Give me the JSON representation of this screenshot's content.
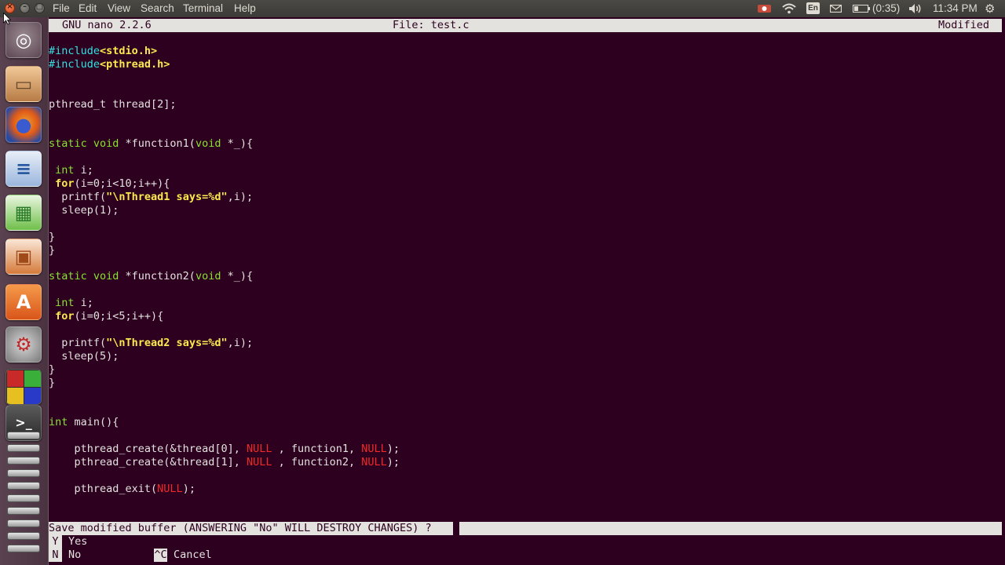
{
  "menubar": {
    "items": [
      "File",
      "Edit",
      "View",
      "Search",
      "Terminal",
      "Help"
    ]
  },
  "indicators": {
    "keyboard": "En",
    "battery": "(0:35)",
    "time": "11:34 PM",
    "gear": "⚙",
    "icons": [
      "record-icon",
      "wifi-icon",
      "keyboard-layout-icon",
      "mail-icon",
      "battery-icon",
      "volume-icon",
      "session-gear-icon"
    ]
  },
  "window_controls": {
    "close": "×",
    "minimize": "–",
    "maximize": "□"
  },
  "launcher": {
    "items": [
      "dash-home-icon",
      "files-icon",
      "firefox-icon",
      "libreoffice-writer-icon",
      "libreoffice-calc-icon",
      "libreoffice-impress-icon",
      "software-center-icon",
      "system-settings-icon",
      "workspace-switcher-icon",
      "terminal-icon"
    ],
    "glyphs": {
      "dash": "◎",
      "files": "▭",
      "firefox": "●",
      "writer": "≡",
      "calc": "▦",
      "impress": "▣",
      "software": "A",
      "settings": "⚙",
      "terminal": ">_"
    }
  },
  "nano": {
    "version": "GNU nano 2.2.6",
    "filename": "File: test.c",
    "status": "Modified"
  },
  "code": {
    "lines": [
      {
        "row": 0,
        "text": "",
        "tokens": [
          {
            "t": "#include",
            "c": "pre"
          },
          {
            "t": "<stdio.h>",
            "c": "inc"
          }
        ]
      },
      {
        "row": 1,
        "tokens": [
          {
            "t": "#include",
            "c": "pre"
          },
          {
            "t": "<pthread.h>",
            "c": "inc"
          }
        ]
      },
      {
        "row": 4,
        "tokens": [
          {
            "t": "pthread_t thread[2];",
            "c": "plain"
          }
        ]
      },
      {
        "row": 7,
        "tokens": [
          {
            "t": "static void",
            "c": "kw"
          },
          {
            "t": " *function1(",
            "c": "plain"
          },
          {
            "t": "void",
            "c": "kw"
          },
          {
            "t": " *_){",
            "c": "plain"
          }
        ]
      },
      {
        "row": 9,
        "tokens": [
          {
            "t": " int",
            "c": "kw"
          },
          {
            "t": " i;",
            "c": "plain"
          }
        ]
      },
      {
        "row": 10,
        "tokens": [
          {
            "t": " for",
            "c": "ctl"
          },
          {
            "t": "(i=0;i<10;i++){",
            "c": "plain"
          }
        ]
      },
      {
        "row": 11,
        "tokens": [
          {
            "t": "  printf(",
            "c": "plain"
          },
          {
            "t": "\"\\nThread1 says=%d\"",
            "c": "str"
          },
          {
            "t": ",i);",
            "c": "plain"
          }
        ]
      },
      {
        "row": 12,
        "tokens": [
          {
            "t": "  sleep(1);",
            "c": "plain"
          }
        ]
      },
      {
        "row": 14,
        "tokens": [
          {
            "t": "}",
            "c": "plain"
          }
        ]
      },
      {
        "row": 15,
        "tokens": [
          {
            "t": "}",
            "c": "plain"
          }
        ]
      },
      {
        "row": 17,
        "tokens": [
          {
            "t": "static void",
            "c": "kw"
          },
          {
            "t": " *function2(",
            "c": "plain"
          },
          {
            "t": "void",
            "c": "kw"
          },
          {
            "t": " *_){",
            "c": "plain"
          }
        ]
      },
      {
        "row": 19,
        "tokens": [
          {
            "t": " int",
            "c": "kw"
          },
          {
            "t": " i;",
            "c": "plain"
          }
        ]
      },
      {
        "row": 20,
        "tokens": [
          {
            "t": " for",
            "c": "ctl"
          },
          {
            "t": "(i=0;i<5;i++){",
            "c": "plain"
          }
        ]
      },
      {
        "row": 22,
        "tokens": [
          {
            "t": "  printf(",
            "c": "plain"
          },
          {
            "t": "\"\\nThread2 says=%d\"",
            "c": "str"
          },
          {
            "t": ",i);",
            "c": "plain"
          }
        ]
      },
      {
        "row": 23,
        "tokens": [
          {
            "t": "  sleep(5);",
            "c": "plain"
          }
        ]
      },
      {
        "row": 24,
        "tokens": [
          {
            "t": "}",
            "c": "plain"
          }
        ]
      },
      {
        "row": 25,
        "tokens": [
          {
            "t": "}",
            "c": "plain"
          }
        ]
      },
      {
        "row": 28,
        "tokens": [
          {
            "t": "int",
            "c": "kw"
          },
          {
            "t": " main(){",
            "c": "plain"
          }
        ]
      },
      {
        "row": 30,
        "tokens": [
          {
            "t": "    pthread_create(&thread[0], ",
            "c": "plain"
          },
          {
            "t": "NULL",
            "c": "null"
          },
          {
            "t": " , function1, ",
            "c": "plain"
          },
          {
            "t": "NULL",
            "c": "null"
          },
          {
            "t": ");",
            "c": "plain"
          }
        ]
      },
      {
        "row": 31,
        "tokens": [
          {
            "t": "    pthread_create(&thread[1], ",
            "c": "plain"
          },
          {
            "t": "NULL",
            "c": "null"
          },
          {
            "t": " , function2, ",
            "c": "plain"
          },
          {
            "t": "NULL",
            "c": "null"
          },
          {
            "t": ");",
            "c": "plain"
          }
        ]
      },
      {
        "row": 33,
        "tokens": [
          {
            "t": "    pthread_exit(",
            "c": "plain"
          },
          {
            "t": "NULL",
            "c": "null"
          },
          {
            "t": ");",
            "c": "plain"
          }
        ]
      }
    ]
  },
  "prompt": {
    "question": "Save modified buffer (ANSWERING \"No\" WILL DESTROY CHANGES) ? ",
    "answer": ""
  },
  "shortcuts": {
    "yes_key": "Y",
    "yes_label": "Yes",
    "no_key": "N",
    "no_label": "No",
    "cancel_key": "^C",
    "cancel_label": "Cancel"
  },
  "colors": {
    "terminal_bg": "#2c001e",
    "text": "#e4e2df",
    "preprocessor": "#34e2e2",
    "string": "#fce94f",
    "keyword": "#8ae234",
    "null": "#ef2929"
  }
}
